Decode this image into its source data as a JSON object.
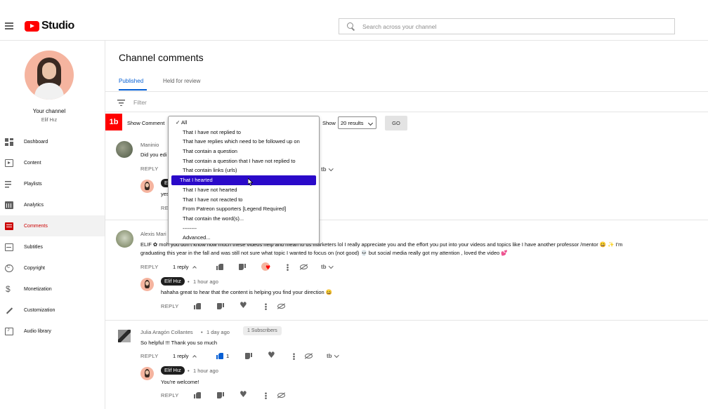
{
  "header": {
    "logo_text": "Studio",
    "search_placeholder": "Search across your channel"
  },
  "sidebar": {
    "your_channel": "Your channel",
    "channel_name": "Elif Hız",
    "items": [
      {
        "label": "Dashboard",
        "icon": "dashboard-icon"
      },
      {
        "label": "Content",
        "icon": "content-icon"
      },
      {
        "label": "Playlists",
        "icon": "playlists-icon"
      },
      {
        "label": "Analytics",
        "icon": "analytics-icon"
      },
      {
        "label": "Comments",
        "icon": "comments-icon",
        "active": true
      },
      {
        "label": "Subtitles",
        "icon": "subtitles-icon"
      },
      {
        "label": "Copyright",
        "icon": "copyright-icon"
      },
      {
        "label": "Monetization",
        "icon": "monetization-icon"
      },
      {
        "label": "Customization",
        "icon": "customization-icon"
      },
      {
        "label": "Audio library",
        "icon": "audio-library-icon"
      }
    ]
  },
  "main": {
    "title": "Channel comments",
    "tabs": [
      "Published",
      "Held for review"
    ],
    "filter_placeholder": "Filter"
  },
  "toolbar": {
    "show_comments_label": "Show Comment",
    "show_label": "Show",
    "results_value": "20 results",
    "go_label": "GO"
  },
  "dropdown": {
    "options": [
      "All",
      "That I have not replied to",
      "That have replies which need to be followed up on",
      "That contain a question",
      "That contain a question that I have not replied to",
      "That contain links (urls)",
      "That I hearted",
      "That I have not hearted",
      "That I have not reacted to",
      "From Patreon supporters [Legend Required]",
      "That contain the word(s)...",
      "--------",
      "Advanced..."
    ],
    "checked": "✓ All",
    "selected_index": 6
  },
  "comments": [
    {
      "author": "Maninio",
      "text": "Did you edi",
      "reply_label": "REPLY",
      "reply": {
        "author_chip": "El",
        "text": "yes"
      },
      "reply_reply_label": "REP"
    },
    {
      "author": "Alexis Mari",
      "text_line1": "ELIF ✿ moh you don't know how much these videos help and mean to us marketers lol I really appreciate you and the effort you put into your videos and topics like I have another professor /mentor 😀 ✨ I'm",
      "text_line2": "graduating this year in the fall and was still not sure what topic I wanted to focus on (not good) 💀  but social media really got my attention , loved the video 💕",
      "reply_label": "REPLY",
      "replies_label": "1 reply",
      "reply": {
        "author_chip": "Elif Hız",
        "time": "1 hour ago",
        "text": "hahaha great to hear that the content is helping you find your direction 😀",
        "reply_label": "REPLY"
      }
    },
    {
      "author": "Julia Aragón Collantes",
      "time": "1 day ago",
      "subscribers": "1 Subscribers",
      "text": "So helpful !!! Thank you so much",
      "reply_label": "REPLY",
      "replies_label": "1 reply",
      "like_count": "1",
      "reply": {
        "author_chip": "Elif Hız",
        "time": "1 hour ago",
        "text": "You're welcome!",
        "reply_label": "REPLY"
      }
    }
  ],
  "common": {
    "dot_separator": "•",
    "tb_mini": "tb"
  },
  "colors": {
    "accent": "#065fd4",
    "brand_red": "#ff0000",
    "active_nav": "#cc0000",
    "dropdown_highlight": "#2a09c9"
  }
}
